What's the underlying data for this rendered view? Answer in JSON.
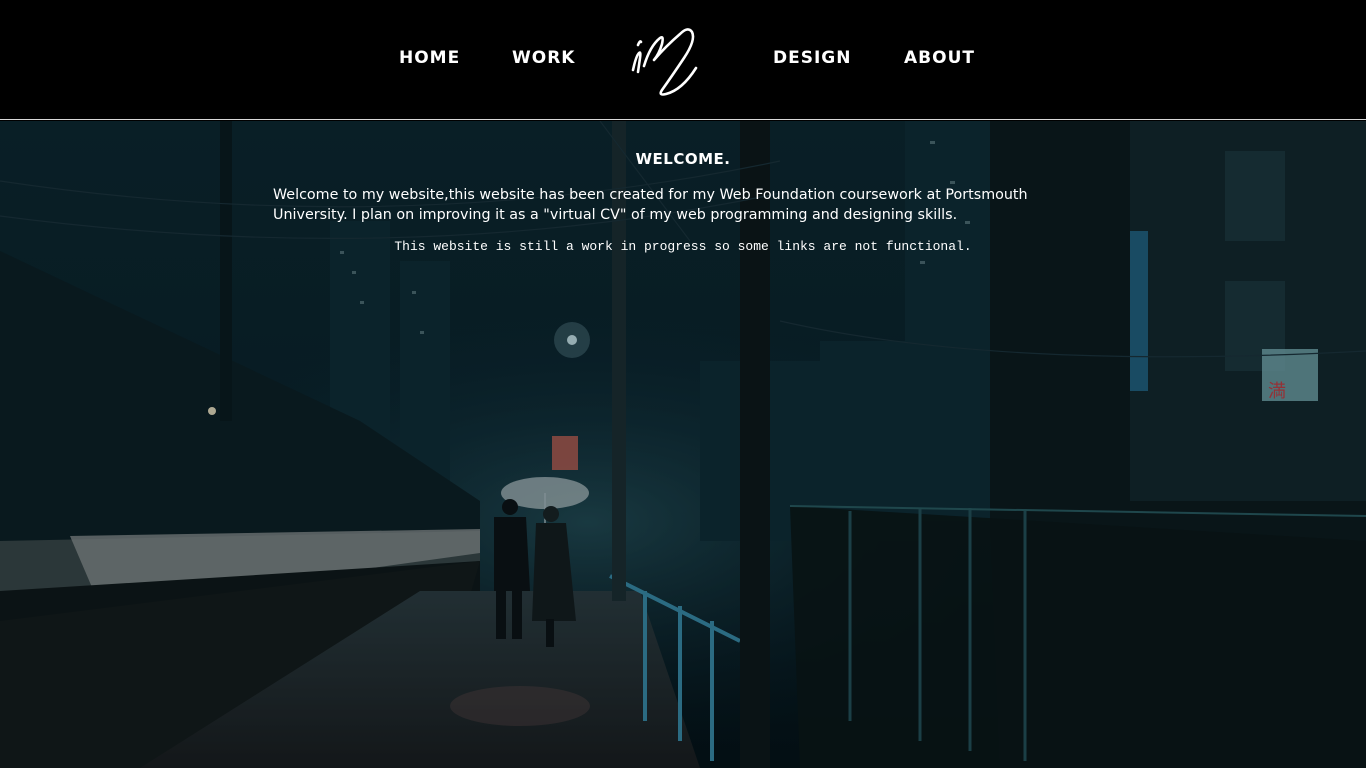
{
  "nav": {
    "items": [
      {
        "label": "HOME"
      },
      {
        "label": "WORK"
      },
      {
        "label": "DESIGN"
      },
      {
        "label": "ABOUT"
      }
    ]
  },
  "main": {
    "title": "WELCOME.",
    "intro": "Welcome to my website,this website has been created for my Web Foundation coursework at Portsmouth University. I plan on improving it as a \"virtual CV\" of my web programming and designing skills.",
    "note": "This website is still a work in progress so some links are not functional."
  },
  "background": {
    "sign_character": "満"
  },
  "colors": {
    "header_bg": "#000000",
    "text": "#ffffff",
    "scene_dark": "#0b1d22"
  }
}
